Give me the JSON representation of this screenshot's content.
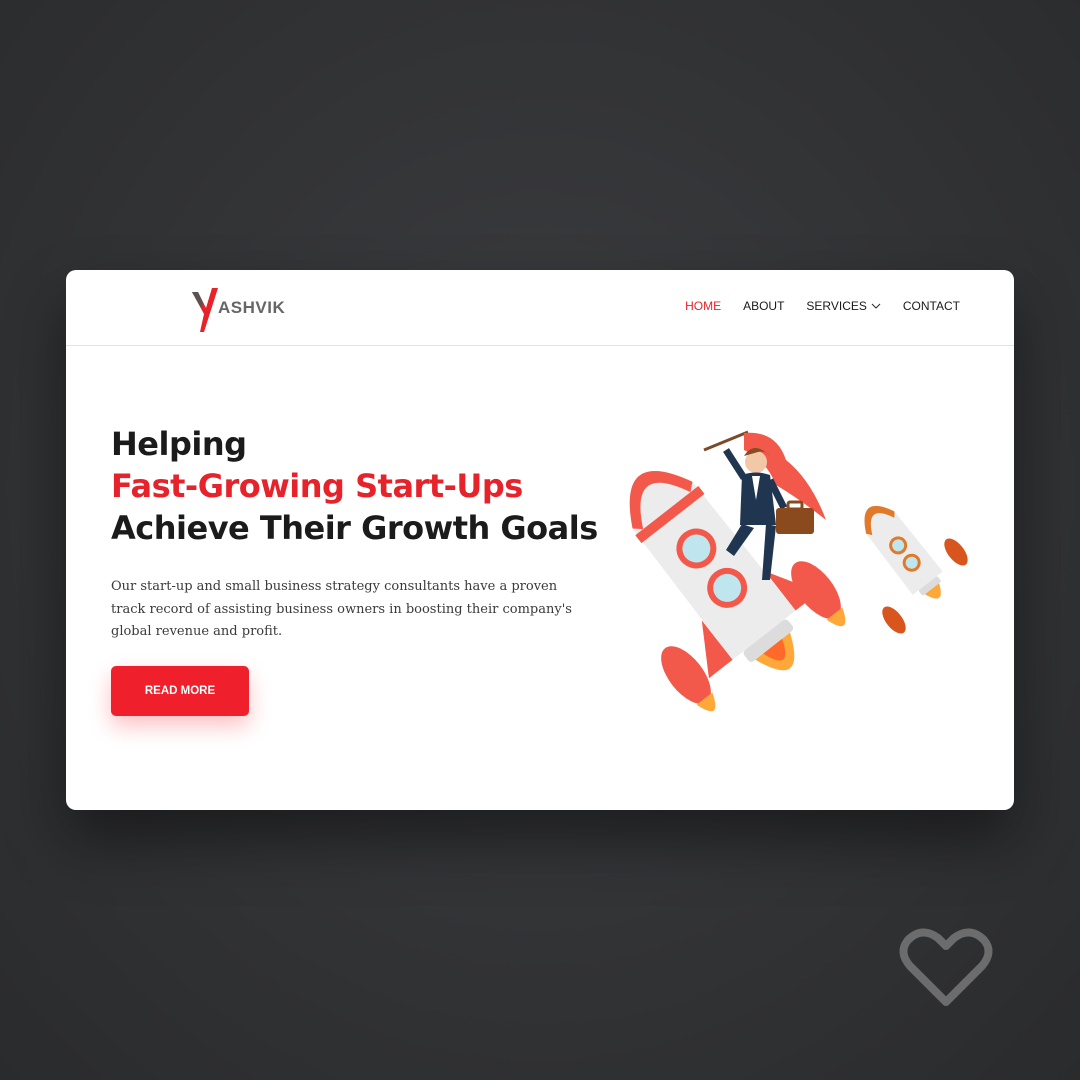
{
  "brand": {
    "logo_text": "ASHVIK",
    "accent": "#e6232a"
  },
  "nav": {
    "items": [
      {
        "label": "HOME",
        "active": true
      },
      {
        "label": "ABOUT",
        "active": false
      },
      {
        "label": "SERVICES",
        "active": false,
        "icon": "chevron-down-icon"
      },
      {
        "label": "CONTACT",
        "active": false
      }
    ]
  },
  "hero": {
    "title_line1": "Helping",
    "title_line2": "Fast-Growing Start-Ups",
    "title_line3": "Achieve Their Growth Goals",
    "description": "Our start-up and small business strategy consultants have a proven track record of assisting business owners in boosting their company's global revenue and profit.",
    "cta_label": "READ MORE"
  },
  "overlay": {
    "icon": "heart-icon"
  }
}
